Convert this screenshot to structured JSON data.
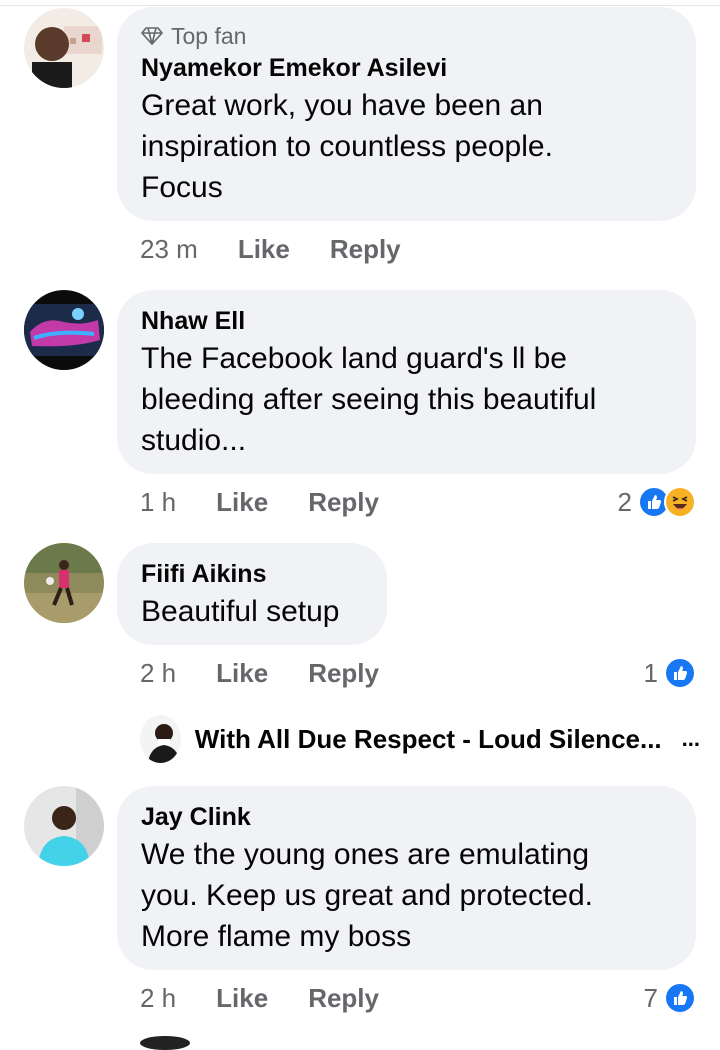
{
  "comments": [
    {
      "badge": "Top fan",
      "author": "Nyamekor Emekor Asilevi",
      "text_lines": [
        "Great work, you have been an",
        "inspiration to countless people.",
        "Focus"
      ],
      "time": "23 m",
      "like": "Like",
      "reply": "Reply",
      "reaction_count": ""
    },
    {
      "author": "Nhaw Ell",
      "text_lines": [
        "The Facebook land guard's  ll be",
        "bleeding  after seeing this beautiful",
        "studio..."
      ],
      "time": "1 h",
      "like": "Like",
      "reply": "Reply",
      "reaction_count": "2"
    },
    {
      "author": "Fiifi Aikins",
      "text_lines": [
        "Beautiful setup"
      ],
      "time": "2 h",
      "like": "Like",
      "reply": "Reply",
      "reaction_count": "1"
    },
    {
      "author": "Jay Clink",
      "text_lines": [
        "We the young ones are emulating",
        "you. Keep us great and protected.",
        "More flame my boss"
      ],
      "time": "2 h",
      "like": "Like",
      "reply": "Reply",
      "reaction_count": "7"
    }
  ],
  "reply_thread": {
    "title": "With All Due Respect - Loud Silence...",
    "more": "..."
  },
  "colors": {
    "bubble": "#f0f2f5",
    "like_blue": "#1877f2",
    "haha_yellow": "#f7b125",
    "meta_gray": "#65676b"
  }
}
